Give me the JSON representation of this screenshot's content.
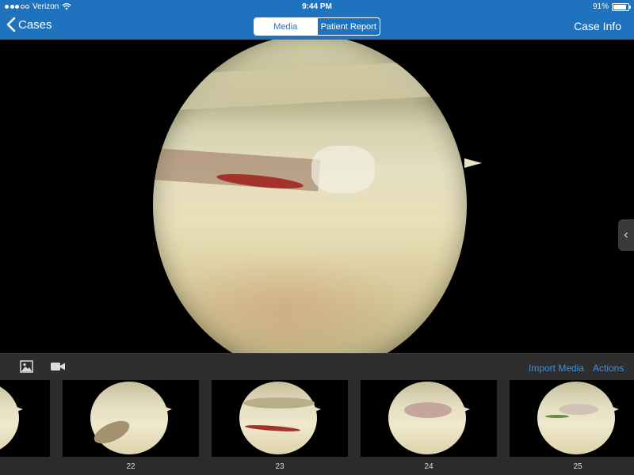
{
  "status_bar": {
    "carrier": "Verizon",
    "time": "9:44 PM",
    "battery_percent": "91%",
    "battery_level": 0.91
  },
  "nav": {
    "back_label": "Cases",
    "segments": [
      "Media",
      "Patient Report"
    ],
    "selected_segment": "Media",
    "right_label": "Case Info"
  },
  "toolbar": {
    "left_icons": [
      "photo-icon",
      "video-camera-icon"
    ],
    "import_label": "Import Media",
    "actions_label": "Actions"
  },
  "thumbnails": [
    {
      "label": ""
    },
    {
      "label": "22"
    },
    {
      "label": "23"
    },
    {
      "label": "24"
    },
    {
      "label": "25"
    }
  ],
  "colors": {
    "nav_blue": "#1f72bd",
    "link_blue": "#3d8fe0",
    "toolbar_bg": "#2e2e2e"
  }
}
